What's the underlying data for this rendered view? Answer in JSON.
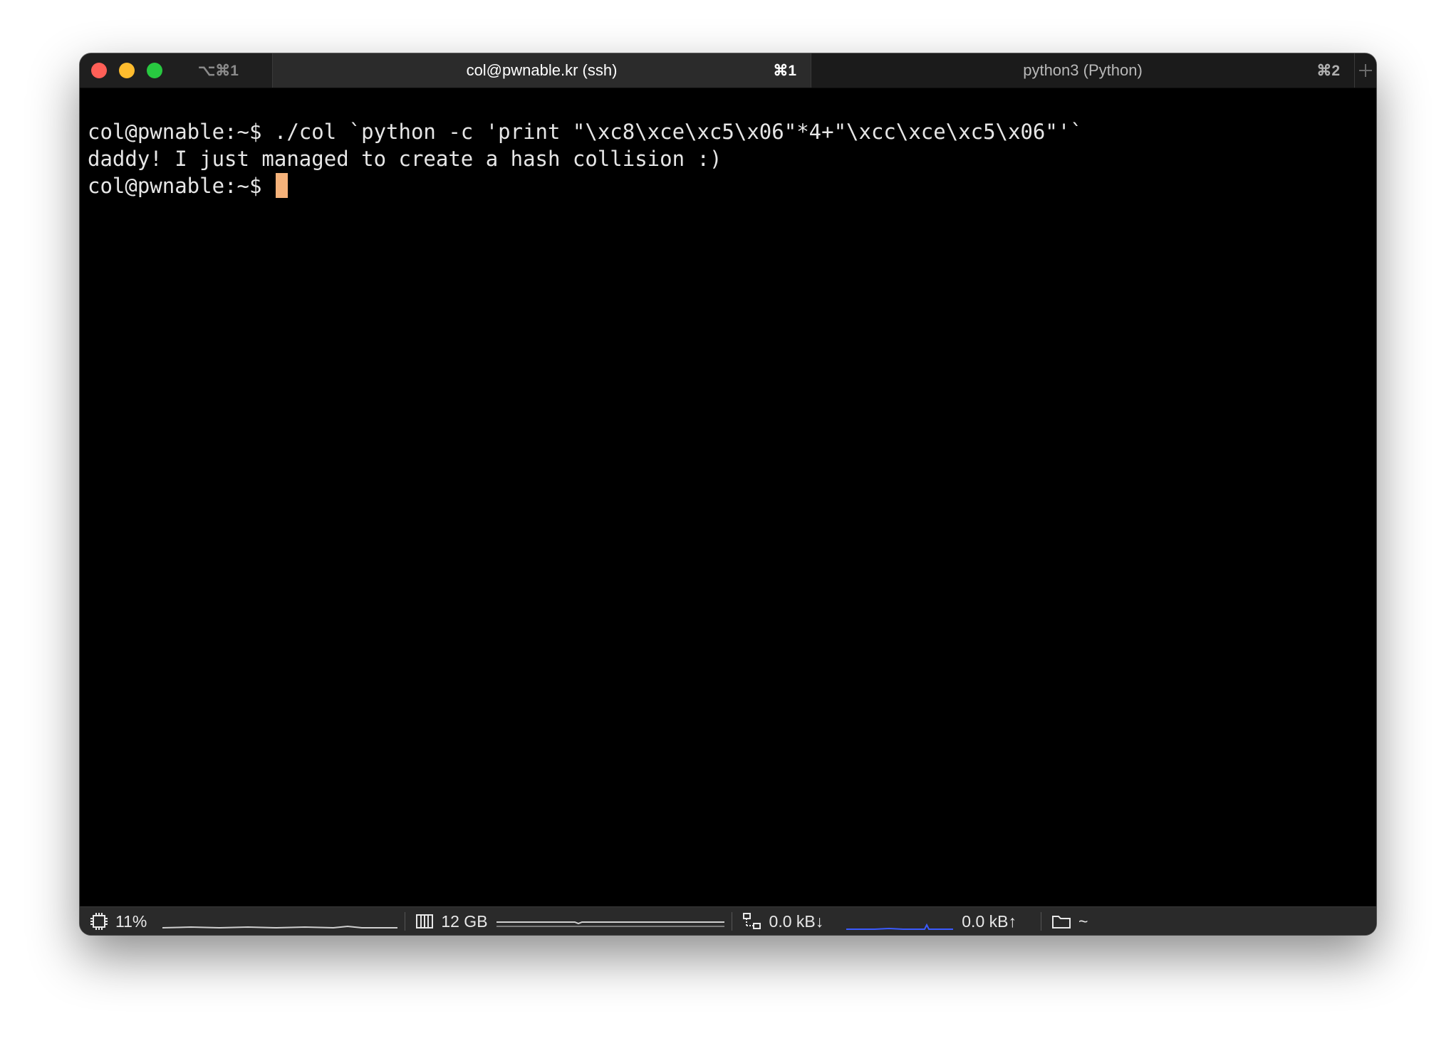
{
  "window": {
    "shortcut": "⌥⌘1"
  },
  "tabs": [
    {
      "label": "col@pwnable.kr (ssh)",
      "shortcut": "⌘1",
      "active": true
    },
    {
      "label": "python3 (Python)",
      "shortcut": "⌘2",
      "active": false
    }
  ],
  "new_tab_icon": "plus-icon",
  "terminal": {
    "lines": [
      "col@pwnable:~$ ./col `python -c 'print \"\\xc8\\xce\\xc5\\x06\"*4+\"\\xcc\\xce\\xc5\\x06\"'`",
      "daddy! I just managed to create a hash collision :)"
    ],
    "prompt": "col@pwnable:~$ ",
    "cursor_color": "#f5b27a"
  },
  "statusbar": {
    "cpu": {
      "icon": "cpu-icon",
      "value": "11%"
    },
    "memory": {
      "icon": "memory-icon",
      "value": "12 GB"
    },
    "network_down": {
      "icon": "network-icon",
      "value": "0.0 kB↓"
    },
    "network_up": {
      "value": "0.0 kB↑"
    },
    "directory": {
      "icon": "folder-icon",
      "value": "~"
    }
  },
  "colors": {
    "background": "#000000",
    "text": "#e6e6e6",
    "tabbar": "#1f1f1f",
    "active_tab": "#2b2b2b",
    "statusbar": "#2a2a2a",
    "close": "#ff5f57",
    "minimize": "#febc2e",
    "zoom": "#28c840",
    "network_graph": "#3b5bff"
  }
}
